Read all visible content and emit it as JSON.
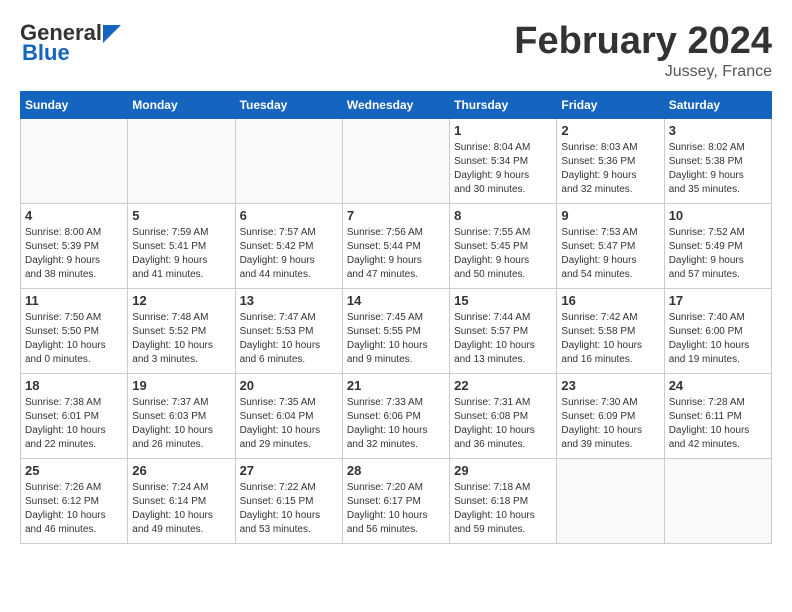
{
  "header": {
    "logo_general": "General",
    "logo_blue": "Blue",
    "month": "February 2024",
    "location": "Jussey, France"
  },
  "days_of_week": [
    "Sunday",
    "Monday",
    "Tuesday",
    "Wednesday",
    "Thursday",
    "Friday",
    "Saturday"
  ],
  "weeks": [
    [
      {
        "day": "",
        "info": ""
      },
      {
        "day": "",
        "info": ""
      },
      {
        "day": "",
        "info": ""
      },
      {
        "day": "",
        "info": ""
      },
      {
        "day": "1",
        "info": "Sunrise: 8:04 AM\nSunset: 5:34 PM\nDaylight: 9 hours\nand 30 minutes."
      },
      {
        "day": "2",
        "info": "Sunrise: 8:03 AM\nSunset: 5:36 PM\nDaylight: 9 hours\nand 32 minutes."
      },
      {
        "day": "3",
        "info": "Sunrise: 8:02 AM\nSunset: 5:38 PM\nDaylight: 9 hours\nand 35 minutes."
      }
    ],
    [
      {
        "day": "4",
        "info": "Sunrise: 8:00 AM\nSunset: 5:39 PM\nDaylight: 9 hours\nand 38 minutes."
      },
      {
        "day": "5",
        "info": "Sunrise: 7:59 AM\nSunset: 5:41 PM\nDaylight: 9 hours\nand 41 minutes."
      },
      {
        "day": "6",
        "info": "Sunrise: 7:57 AM\nSunset: 5:42 PM\nDaylight: 9 hours\nand 44 minutes."
      },
      {
        "day": "7",
        "info": "Sunrise: 7:56 AM\nSunset: 5:44 PM\nDaylight: 9 hours\nand 47 minutes."
      },
      {
        "day": "8",
        "info": "Sunrise: 7:55 AM\nSunset: 5:45 PM\nDaylight: 9 hours\nand 50 minutes."
      },
      {
        "day": "9",
        "info": "Sunrise: 7:53 AM\nSunset: 5:47 PM\nDaylight: 9 hours\nand 54 minutes."
      },
      {
        "day": "10",
        "info": "Sunrise: 7:52 AM\nSunset: 5:49 PM\nDaylight: 9 hours\nand 57 minutes."
      }
    ],
    [
      {
        "day": "11",
        "info": "Sunrise: 7:50 AM\nSunset: 5:50 PM\nDaylight: 10 hours\nand 0 minutes."
      },
      {
        "day": "12",
        "info": "Sunrise: 7:48 AM\nSunset: 5:52 PM\nDaylight: 10 hours\nand 3 minutes."
      },
      {
        "day": "13",
        "info": "Sunrise: 7:47 AM\nSunset: 5:53 PM\nDaylight: 10 hours\nand 6 minutes."
      },
      {
        "day": "14",
        "info": "Sunrise: 7:45 AM\nSunset: 5:55 PM\nDaylight: 10 hours\nand 9 minutes."
      },
      {
        "day": "15",
        "info": "Sunrise: 7:44 AM\nSunset: 5:57 PM\nDaylight: 10 hours\nand 13 minutes."
      },
      {
        "day": "16",
        "info": "Sunrise: 7:42 AM\nSunset: 5:58 PM\nDaylight: 10 hours\nand 16 minutes."
      },
      {
        "day": "17",
        "info": "Sunrise: 7:40 AM\nSunset: 6:00 PM\nDaylight: 10 hours\nand 19 minutes."
      }
    ],
    [
      {
        "day": "18",
        "info": "Sunrise: 7:38 AM\nSunset: 6:01 PM\nDaylight: 10 hours\nand 22 minutes."
      },
      {
        "day": "19",
        "info": "Sunrise: 7:37 AM\nSunset: 6:03 PM\nDaylight: 10 hours\nand 26 minutes."
      },
      {
        "day": "20",
        "info": "Sunrise: 7:35 AM\nSunset: 6:04 PM\nDaylight: 10 hours\nand 29 minutes."
      },
      {
        "day": "21",
        "info": "Sunrise: 7:33 AM\nSunset: 6:06 PM\nDaylight: 10 hours\nand 32 minutes."
      },
      {
        "day": "22",
        "info": "Sunrise: 7:31 AM\nSunset: 6:08 PM\nDaylight: 10 hours\nand 36 minutes."
      },
      {
        "day": "23",
        "info": "Sunrise: 7:30 AM\nSunset: 6:09 PM\nDaylight: 10 hours\nand 39 minutes."
      },
      {
        "day": "24",
        "info": "Sunrise: 7:28 AM\nSunset: 6:11 PM\nDaylight: 10 hours\nand 42 minutes."
      }
    ],
    [
      {
        "day": "25",
        "info": "Sunrise: 7:26 AM\nSunset: 6:12 PM\nDaylight: 10 hours\nand 46 minutes."
      },
      {
        "day": "26",
        "info": "Sunrise: 7:24 AM\nSunset: 6:14 PM\nDaylight: 10 hours\nand 49 minutes."
      },
      {
        "day": "27",
        "info": "Sunrise: 7:22 AM\nSunset: 6:15 PM\nDaylight: 10 hours\nand 53 minutes."
      },
      {
        "day": "28",
        "info": "Sunrise: 7:20 AM\nSunset: 6:17 PM\nDaylight: 10 hours\nand 56 minutes."
      },
      {
        "day": "29",
        "info": "Sunrise: 7:18 AM\nSunset: 6:18 PM\nDaylight: 10 hours\nand 59 minutes."
      },
      {
        "day": "",
        "info": ""
      },
      {
        "day": "",
        "info": ""
      }
    ]
  ]
}
